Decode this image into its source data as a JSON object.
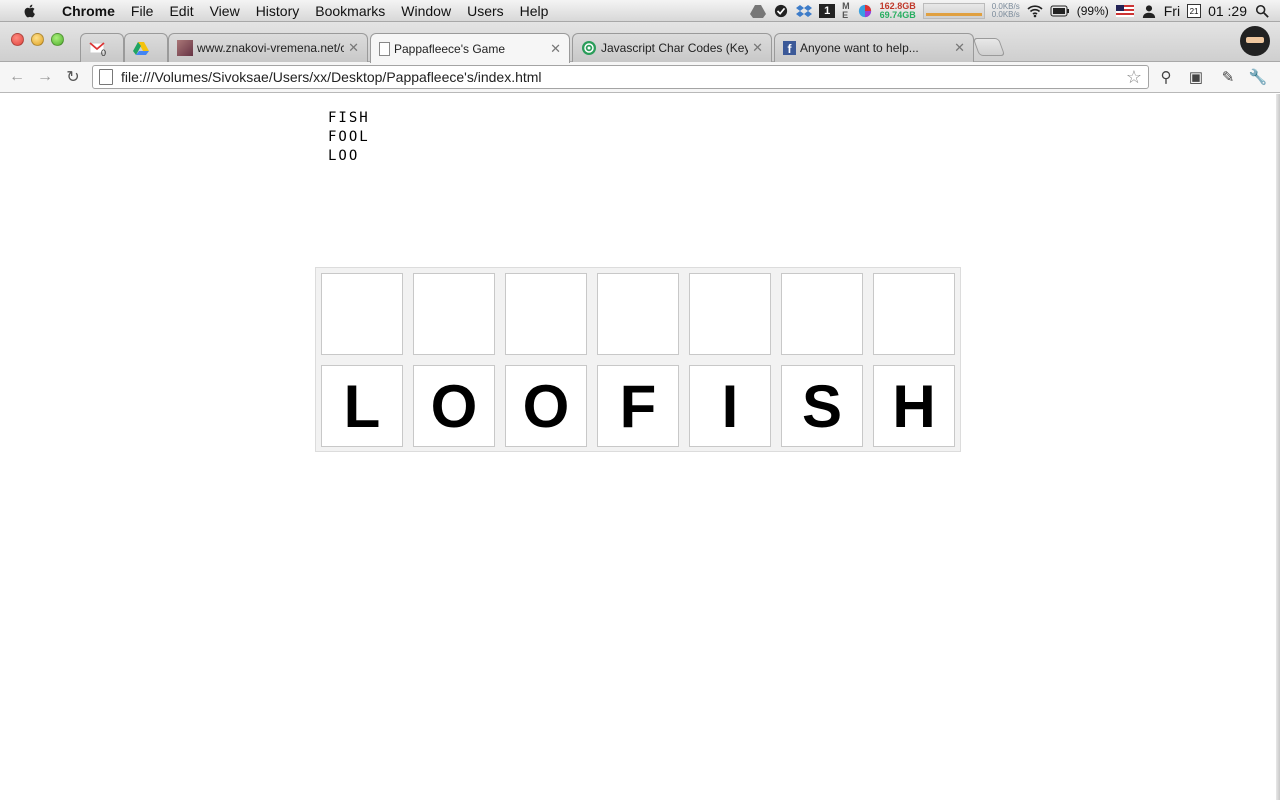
{
  "menubar": {
    "app": "Chrome",
    "items": [
      "File",
      "Edit",
      "View",
      "History",
      "Bookmarks",
      "Window",
      "Users",
      "Help"
    ],
    "mem_used": "162.8GB",
    "mem_free": "69.74GB",
    "net_up": "0.0KB/s",
    "net_down": "0.0KB/s",
    "battery": "(99%)",
    "day": "Fri",
    "cal_date": "21",
    "time": "01 :29"
  },
  "tabs": [
    {
      "title": "",
      "icon": "gmail-icon",
      "badge": "0"
    },
    {
      "title": "",
      "icon": "drive-icon"
    },
    {
      "title": "www.znakovi-vremena.net/c",
      "icon": "site-icon"
    },
    {
      "title": "Pappafleece's Game",
      "icon": "page-icon"
    },
    {
      "title": "Javascript Char Codes (Key C",
      "icon": "site-icon"
    },
    {
      "title": "Anyone want to help...",
      "icon": "facebook-icon"
    }
  ],
  "address": {
    "url": "file:///Volumes/Sivoksae/Users/xx/Desktop/Pappafleece's/index.html"
  },
  "game": {
    "words": [
      "FISH",
      "FOOL",
      "LOO"
    ],
    "top_row": [
      "",
      "",
      "",
      "",
      "",
      "",
      ""
    ],
    "bottom_row": [
      "L",
      "O",
      "O",
      "F",
      "I",
      "S",
      "H"
    ]
  }
}
